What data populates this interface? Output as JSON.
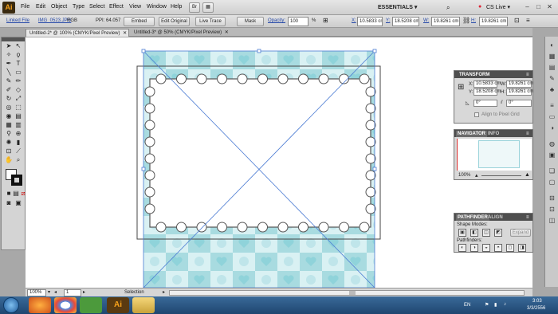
{
  "app": {
    "logo": "Ai"
  },
  "menu": [
    "File",
    "Edit",
    "Object",
    "Type",
    "Select",
    "Effect",
    "View",
    "Window",
    "Help"
  ],
  "workspace": {
    "label": "ESSENTIALS ▾",
    "cslive": "CS Live ▾"
  },
  "control": {
    "linked_file": "Linked File",
    "filename": "IMG_0523.JPG",
    "mode": "RGB",
    "ppi": "PPI: 64.057",
    "embed": "Embed",
    "edit_original": "Edit Original",
    "live_trace": "Live Trace",
    "mask": "Mask",
    "opacity_label": "Opacity:",
    "opacity": "100",
    "pct": "%",
    "x_label": "X:",
    "x": "10.5833 cm",
    "y_label": "Y:",
    "y": "18.5208 cm",
    "w_label": "W:",
    "w": "19.8261 cm",
    "h_label": "H:",
    "h": "19.8261 cm"
  },
  "tabs": [
    {
      "label": "Untitled-2* @ 100% (CMYK/Pixel Preview)",
      "close": "✕"
    },
    {
      "label": "Untitled-3* @ 50% (CMYK/Pixel Preview)",
      "close": "✕"
    }
  ],
  "transform": {
    "title": "TRANSFORM",
    "x_label": "X:",
    "x": "10.5833 cm",
    "y_label": "Y:",
    "y": "18.5208 cm",
    "w_label": "W:",
    "w": "19.8261 cm",
    "h_label": "H:",
    "h": "19.8261 cm",
    "rot": "0°",
    "shear": "0°",
    "align": "Align to Pixel Grid"
  },
  "navigator": {
    "tab1": "NAVIGATOR",
    "tab2": "INFO",
    "zoom": "100%"
  },
  "pathfinder": {
    "tab1": "PATHFINDER",
    "tab2": "ALIGN",
    "shape_modes": "Shape Modes:",
    "expand": "Expand",
    "pathfinders": "Pathfinders:"
  },
  "status": {
    "zoom": "100%",
    "page": "1",
    "tool": "Selection"
  },
  "taskbar": {
    "lang": "EN",
    "time": "3:03",
    "date": "3/3/2556",
    "ai": "Ai"
  },
  "colors": {
    "pattern": "#a8dbe0",
    "heart": "#8fd3da",
    "selection": "#4b7bd3"
  }
}
